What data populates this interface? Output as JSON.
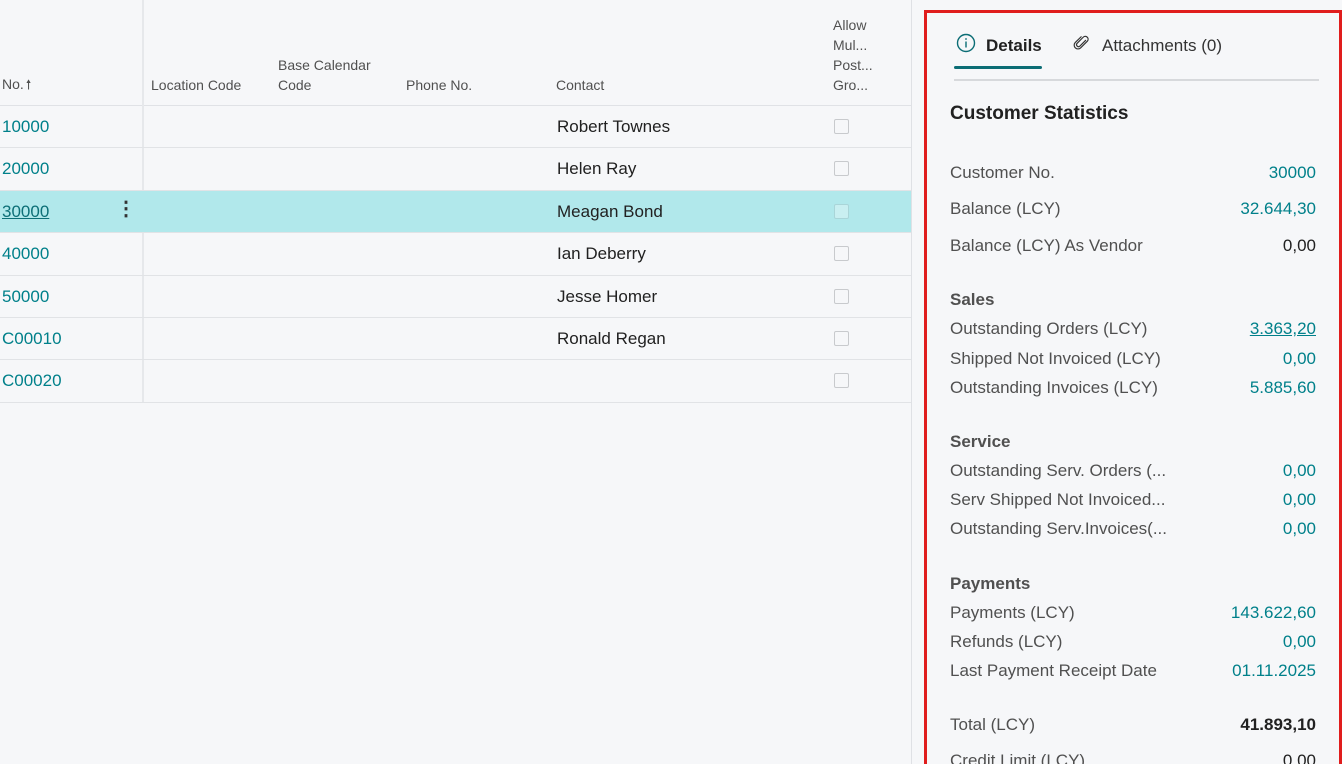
{
  "list": {
    "columns": {
      "no": "No.",
      "no_sort_icon": "arrow-up-icon",
      "location_code": "Location Code",
      "base_calendar_code": "Base Calendar Code",
      "phone_no": "Phone No.",
      "contact": "Contact",
      "allow_multiple": "Allow Mul... Post... Gro..."
    },
    "rows": [
      {
        "no": "10000",
        "contact": "Robert Townes",
        "selected": false
      },
      {
        "no": "20000",
        "contact": "Helen Ray",
        "selected": false
      },
      {
        "no": "30000",
        "contact": "Meagan Bond",
        "selected": true
      },
      {
        "no": "40000",
        "contact": "Ian Deberry",
        "selected": false
      },
      {
        "no": "50000",
        "contact": "Jesse Homer",
        "selected": false
      },
      {
        "no": "C00010",
        "contact": "Ronald Regan",
        "selected": false
      },
      {
        "no": "C00020",
        "contact": "",
        "selected": false
      }
    ],
    "row_menu": "⋮"
  },
  "factbox": {
    "tabs": {
      "details": "Details",
      "attachments": "Attachments (0)"
    },
    "title": "Customer Statistics",
    "customer_no_label": "Customer No.",
    "customer_no_value": "30000",
    "balance_label": "Balance (LCY)",
    "balance_value": "32.644,30",
    "balance_vendor_label": "Balance (LCY) As Vendor",
    "balance_vendor_value": "0,00",
    "sales": {
      "heading": "Sales",
      "outstanding_orders_label": "Outstanding Orders (LCY)",
      "outstanding_orders_value": "3.363,20",
      "shipped_not_invoiced_label": "Shipped Not Invoiced (LCY)",
      "shipped_not_invoiced_value": "0,00",
      "outstanding_invoices_label": "Outstanding Invoices (LCY)",
      "outstanding_invoices_value": "5.885,60"
    },
    "service": {
      "heading": "Service",
      "outstanding_serv_orders_label": "Outstanding Serv. Orders (...",
      "outstanding_serv_orders_value": "0,00",
      "serv_shipped_label": "Serv Shipped Not Invoiced...",
      "serv_shipped_value": "0,00",
      "outstanding_serv_invoices_label": "Outstanding Serv.Invoices(...",
      "outstanding_serv_invoices_value": "0,00"
    },
    "payments": {
      "heading": "Payments",
      "payments_label": "Payments (LCY)",
      "payments_value": "143.622,60",
      "refunds_label": "Refunds (LCY)",
      "refunds_value": "0,00",
      "last_payment_label": "Last Payment Receipt Date",
      "last_payment_value": "01.11.2025"
    },
    "total_label": "Total (LCY)",
    "total_value": "41.893,10",
    "credit_limit_label": "Credit Limit (LCY)",
    "credit_limit_value": "0,00"
  },
  "colors": {
    "accent": "#00808a",
    "selected_row": "#b1e8eb",
    "highlight_border": "#e01d1d"
  }
}
